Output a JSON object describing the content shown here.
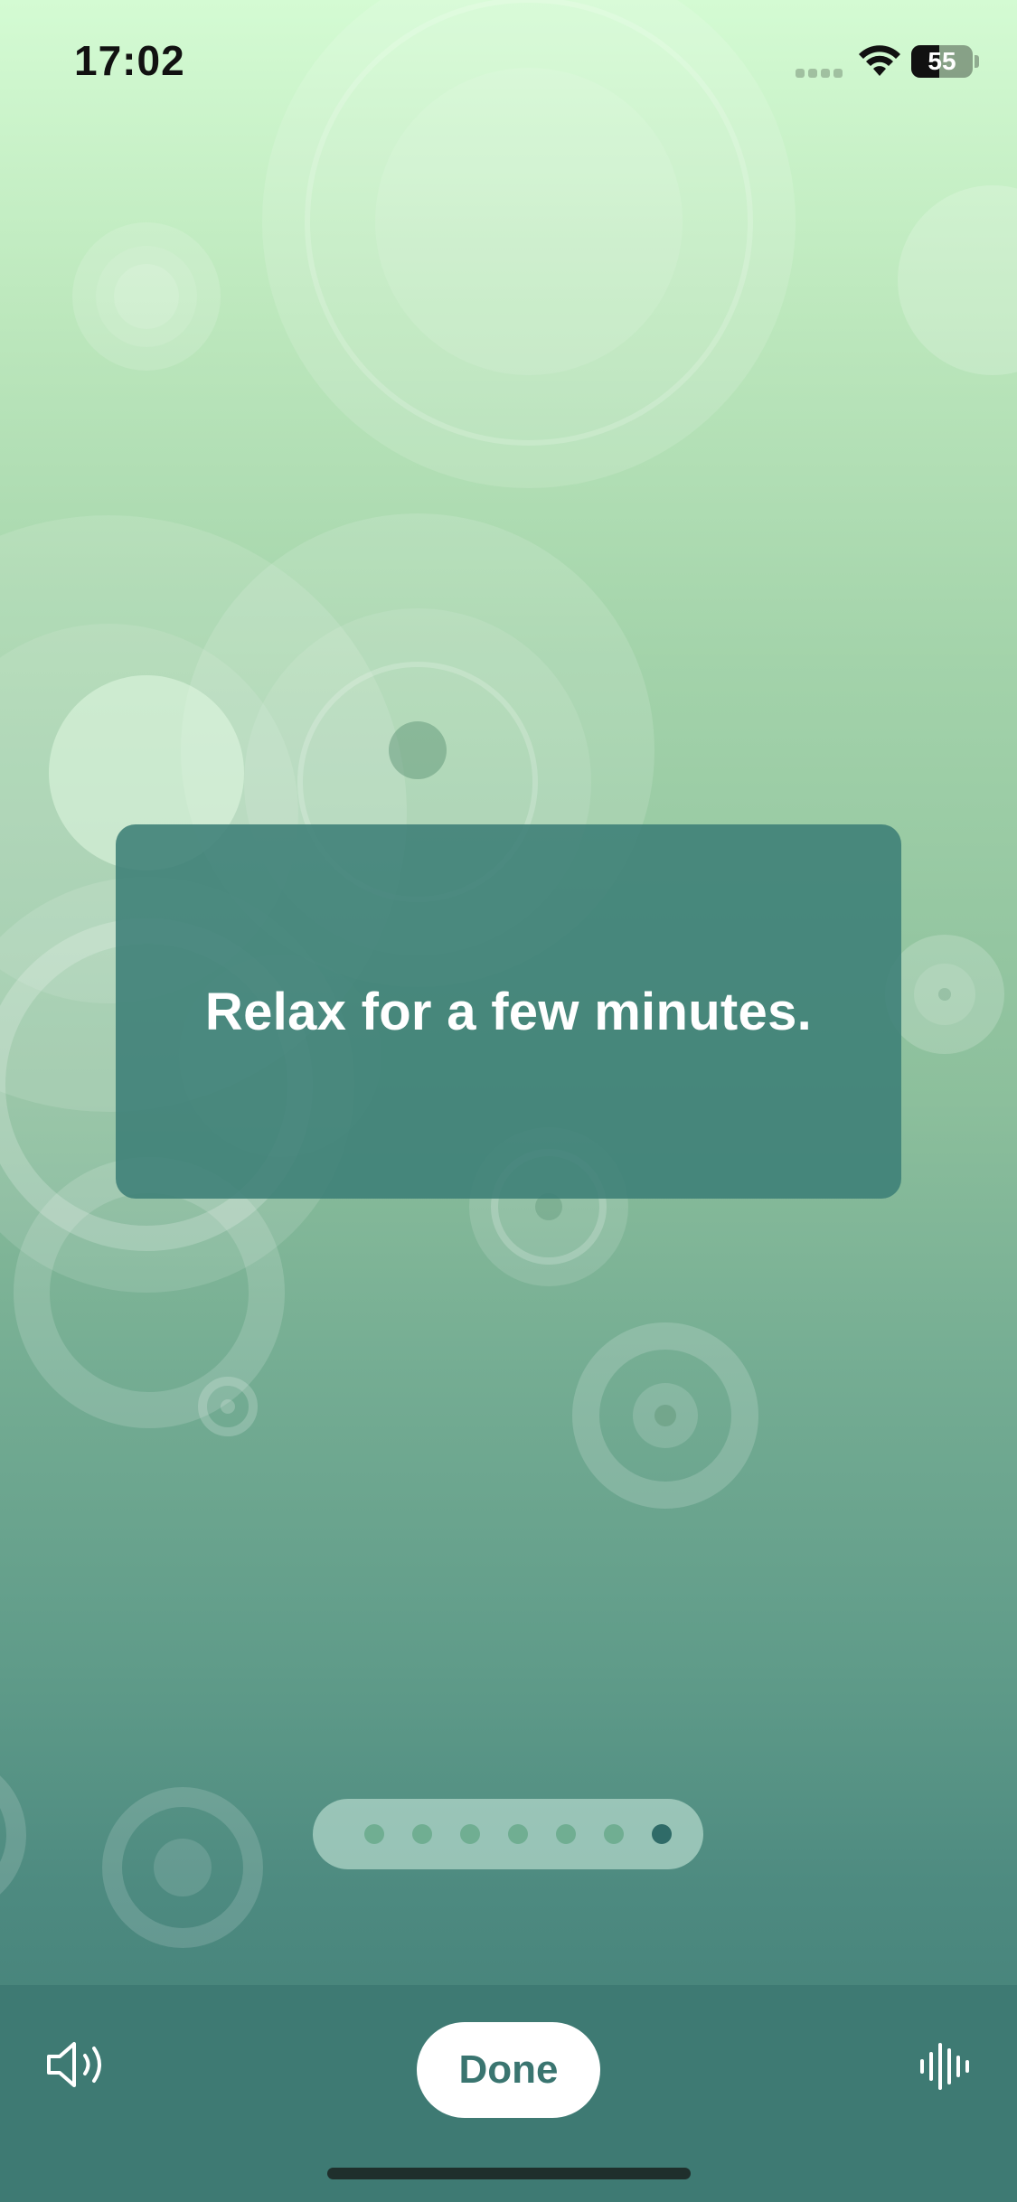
{
  "status_bar": {
    "time": "17:02",
    "battery_level": "55",
    "icons": [
      "signal-icon",
      "wifi-icon",
      "battery-icon"
    ]
  },
  "card": {
    "message": "Relax for a few minutes."
  },
  "pager": {
    "total": 7,
    "current": 7
  },
  "toolbar": {
    "done_label": "Done",
    "left_icon": "speaker-icon",
    "right_icon": "waveform-icon"
  },
  "colors": {
    "background_top": "#d4fbd3",
    "background_bottom": "#3f7b74",
    "card": "#3c7e76",
    "toolbar": "#3e7a73",
    "accent": "#3a7570",
    "active_dot": "#2f6b68"
  }
}
